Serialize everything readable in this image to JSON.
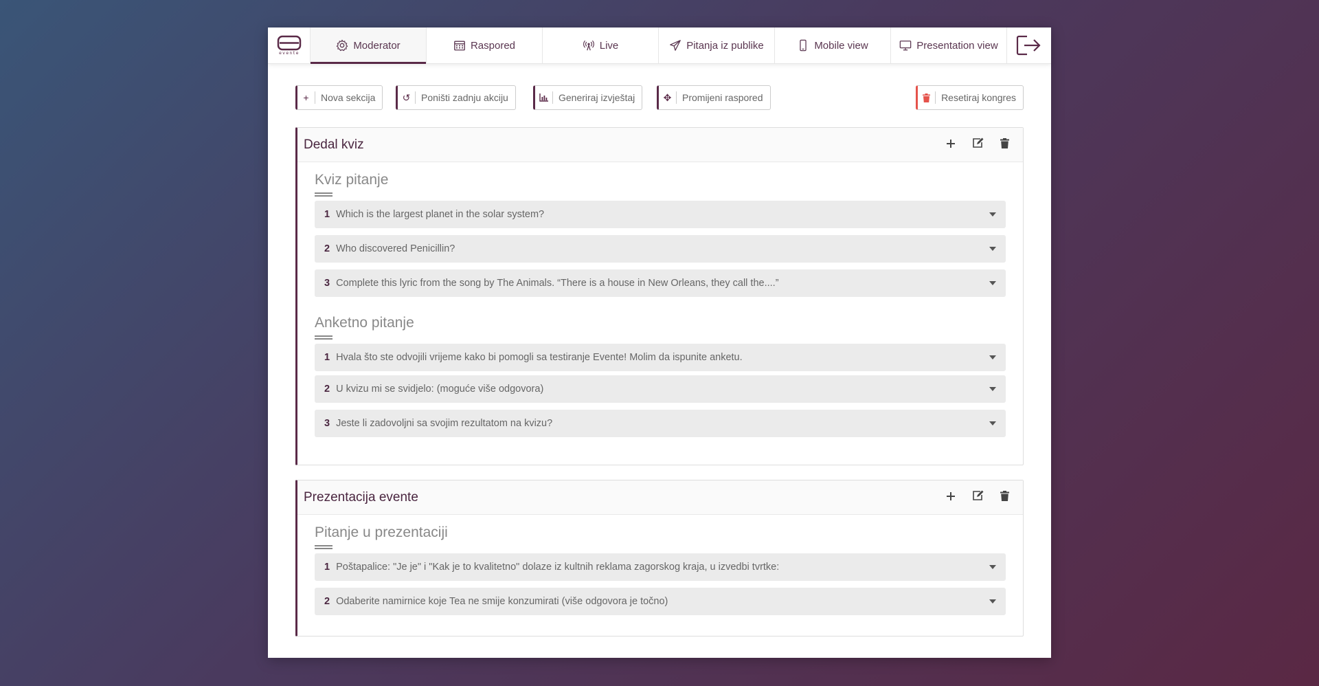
{
  "brand": {
    "logo_text": "evente",
    "accent": "#5a2a48",
    "danger": "#e5534b"
  },
  "nav": {
    "tabs": [
      {
        "label": "Moderator",
        "icon": "gear-icon"
      },
      {
        "label": "Raspored",
        "icon": "calendar-icon"
      },
      {
        "label": "Live",
        "icon": "broadcast-icon"
      },
      {
        "label": "Pitanja iz publike",
        "icon": "paper-plane-icon"
      },
      {
        "label": "Mobile view",
        "icon": "mobile-icon"
      },
      {
        "label": "Presentation view",
        "icon": "monitor-icon"
      }
    ],
    "active_tab": "Moderator",
    "logout_icon": "logout-icon"
  },
  "toolbar": {
    "new_section": "Nova sekcija",
    "undo": "Poništi zadnju akciju",
    "report": "Generiraj izvještaj",
    "reorder": "Promijeni raspored",
    "reset": "Resetiraj kongres"
  },
  "sections": [
    {
      "title": "Dedal kviz",
      "groups": [
        {
          "title": "Kviz pitanje",
          "questions": [
            {
              "num": "1",
              "text": "Which is the largest planet in the solar system?"
            },
            {
              "num": "2",
              "text": "Who discovered Penicillin?"
            },
            {
              "num": "3",
              "text": "Complete this lyric from the song by The Animals. “There is a house in New Orleans, they call the....”"
            }
          ]
        },
        {
          "title": "Anketno pitanje",
          "questions": [
            {
              "num": "1",
              "text": "Hvala što ste odvojili vrijeme kako bi pomogli sa testiranje Evente! Molim da ispunite anketu."
            },
            {
              "num": "2",
              "text": "U kvizu mi se svidjelo: (moguće više odgovora)"
            },
            {
              "num": "3",
              "text": "Jeste li zadovoljni sa svojim rezultatom na kvizu?"
            }
          ]
        }
      ]
    },
    {
      "title": "Prezentacija evente",
      "groups": [
        {
          "title": "Pitanje u prezentaciji",
          "questions": [
            {
              "num": "1",
              "text": "Poštapalice: \"Je je\" i \"Kak je to kvalitetno\" dolaze iz kultnih reklama zagorskog kraja, u izvedbi tvrtke:"
            },
            {
              "num": "2",
              "text": "Odaberite namirnice koje Tea ne smije konzumirati (više odgovora je točno)"
            }
          ]
        }
      ]
    }
  ]
}
